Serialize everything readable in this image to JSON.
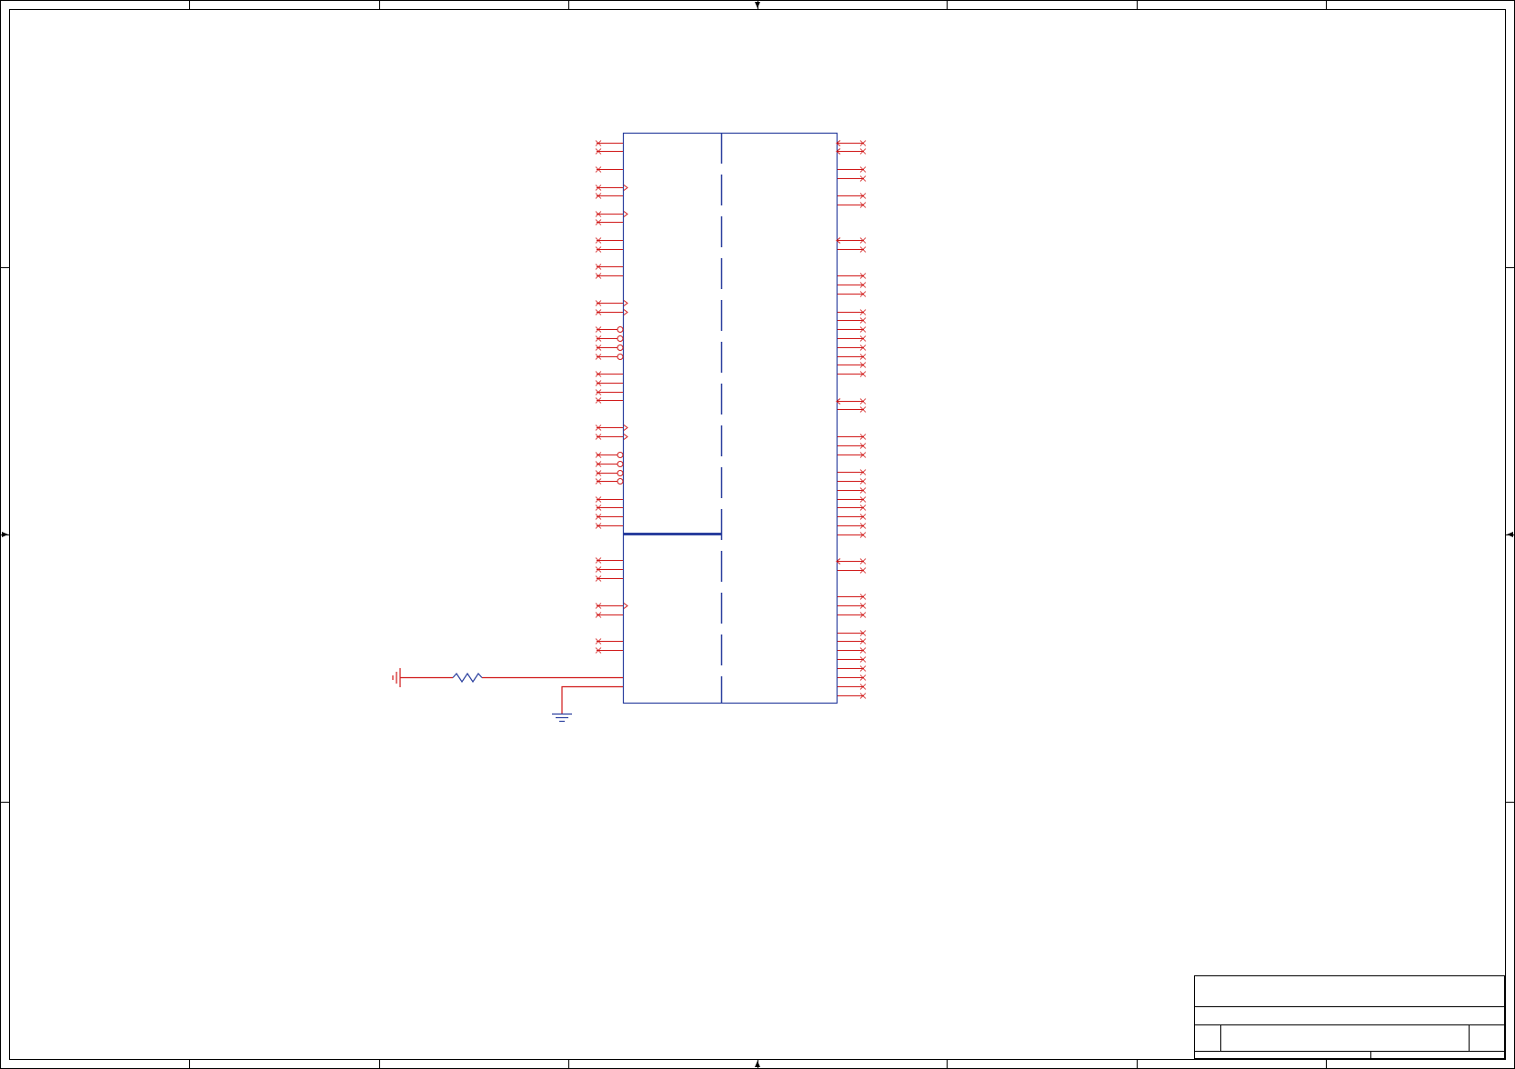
{
  "sheet": {
    "frame_color": "#000000",
    "zone_columns": 8,
    "zone_rows": 4
  },
  "colors": {
    "pin": "#d01818",
    "body": "#2a3f9e",
    "ground": "#d01818",
    "resistor": "#2a3f9e",
    "title_block": "#000000"
  },
  "component": {
    "name": "ic-package",
    "left_pins": 42,
    "right_pins": 48
  },
  "title_block": {
    "title": "",
    "document_number": "",
    "revision": "",
    "size": "",
    "date": "",
    "sheet": ""
  }
}
